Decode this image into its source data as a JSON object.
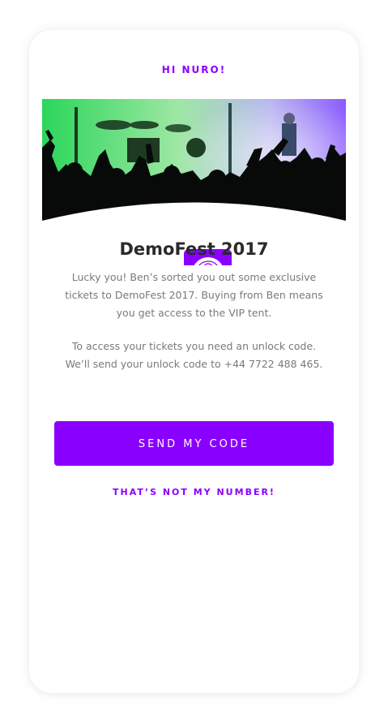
{
  "greeting": "HI NURO!",
  "event": {
    "title": "DemoFest 2017",
    "logo_icon": "mandala-icon"
  },
  "message": {
    "paragraph1": "Lucky you! Ben’s sorted you out some exclusive tickets to DemoFest 2017. Buying from Ben means you get access to the VIP tent.",
    "paragraph2": "To access your tickets you need an unlock code. We’ll send your unlock code to +44 7722 488 465."
  },
  "actions": {
    "send_label": "SEND MY CODE",
    "not_my_number_label": "THAT’S NOT MY NUMBER!"
  },
  "colors": {
    "accent": "#8a00ff",
    "title": "#2a2a2a",
    "body": "#7a7a7a"
  }
}
